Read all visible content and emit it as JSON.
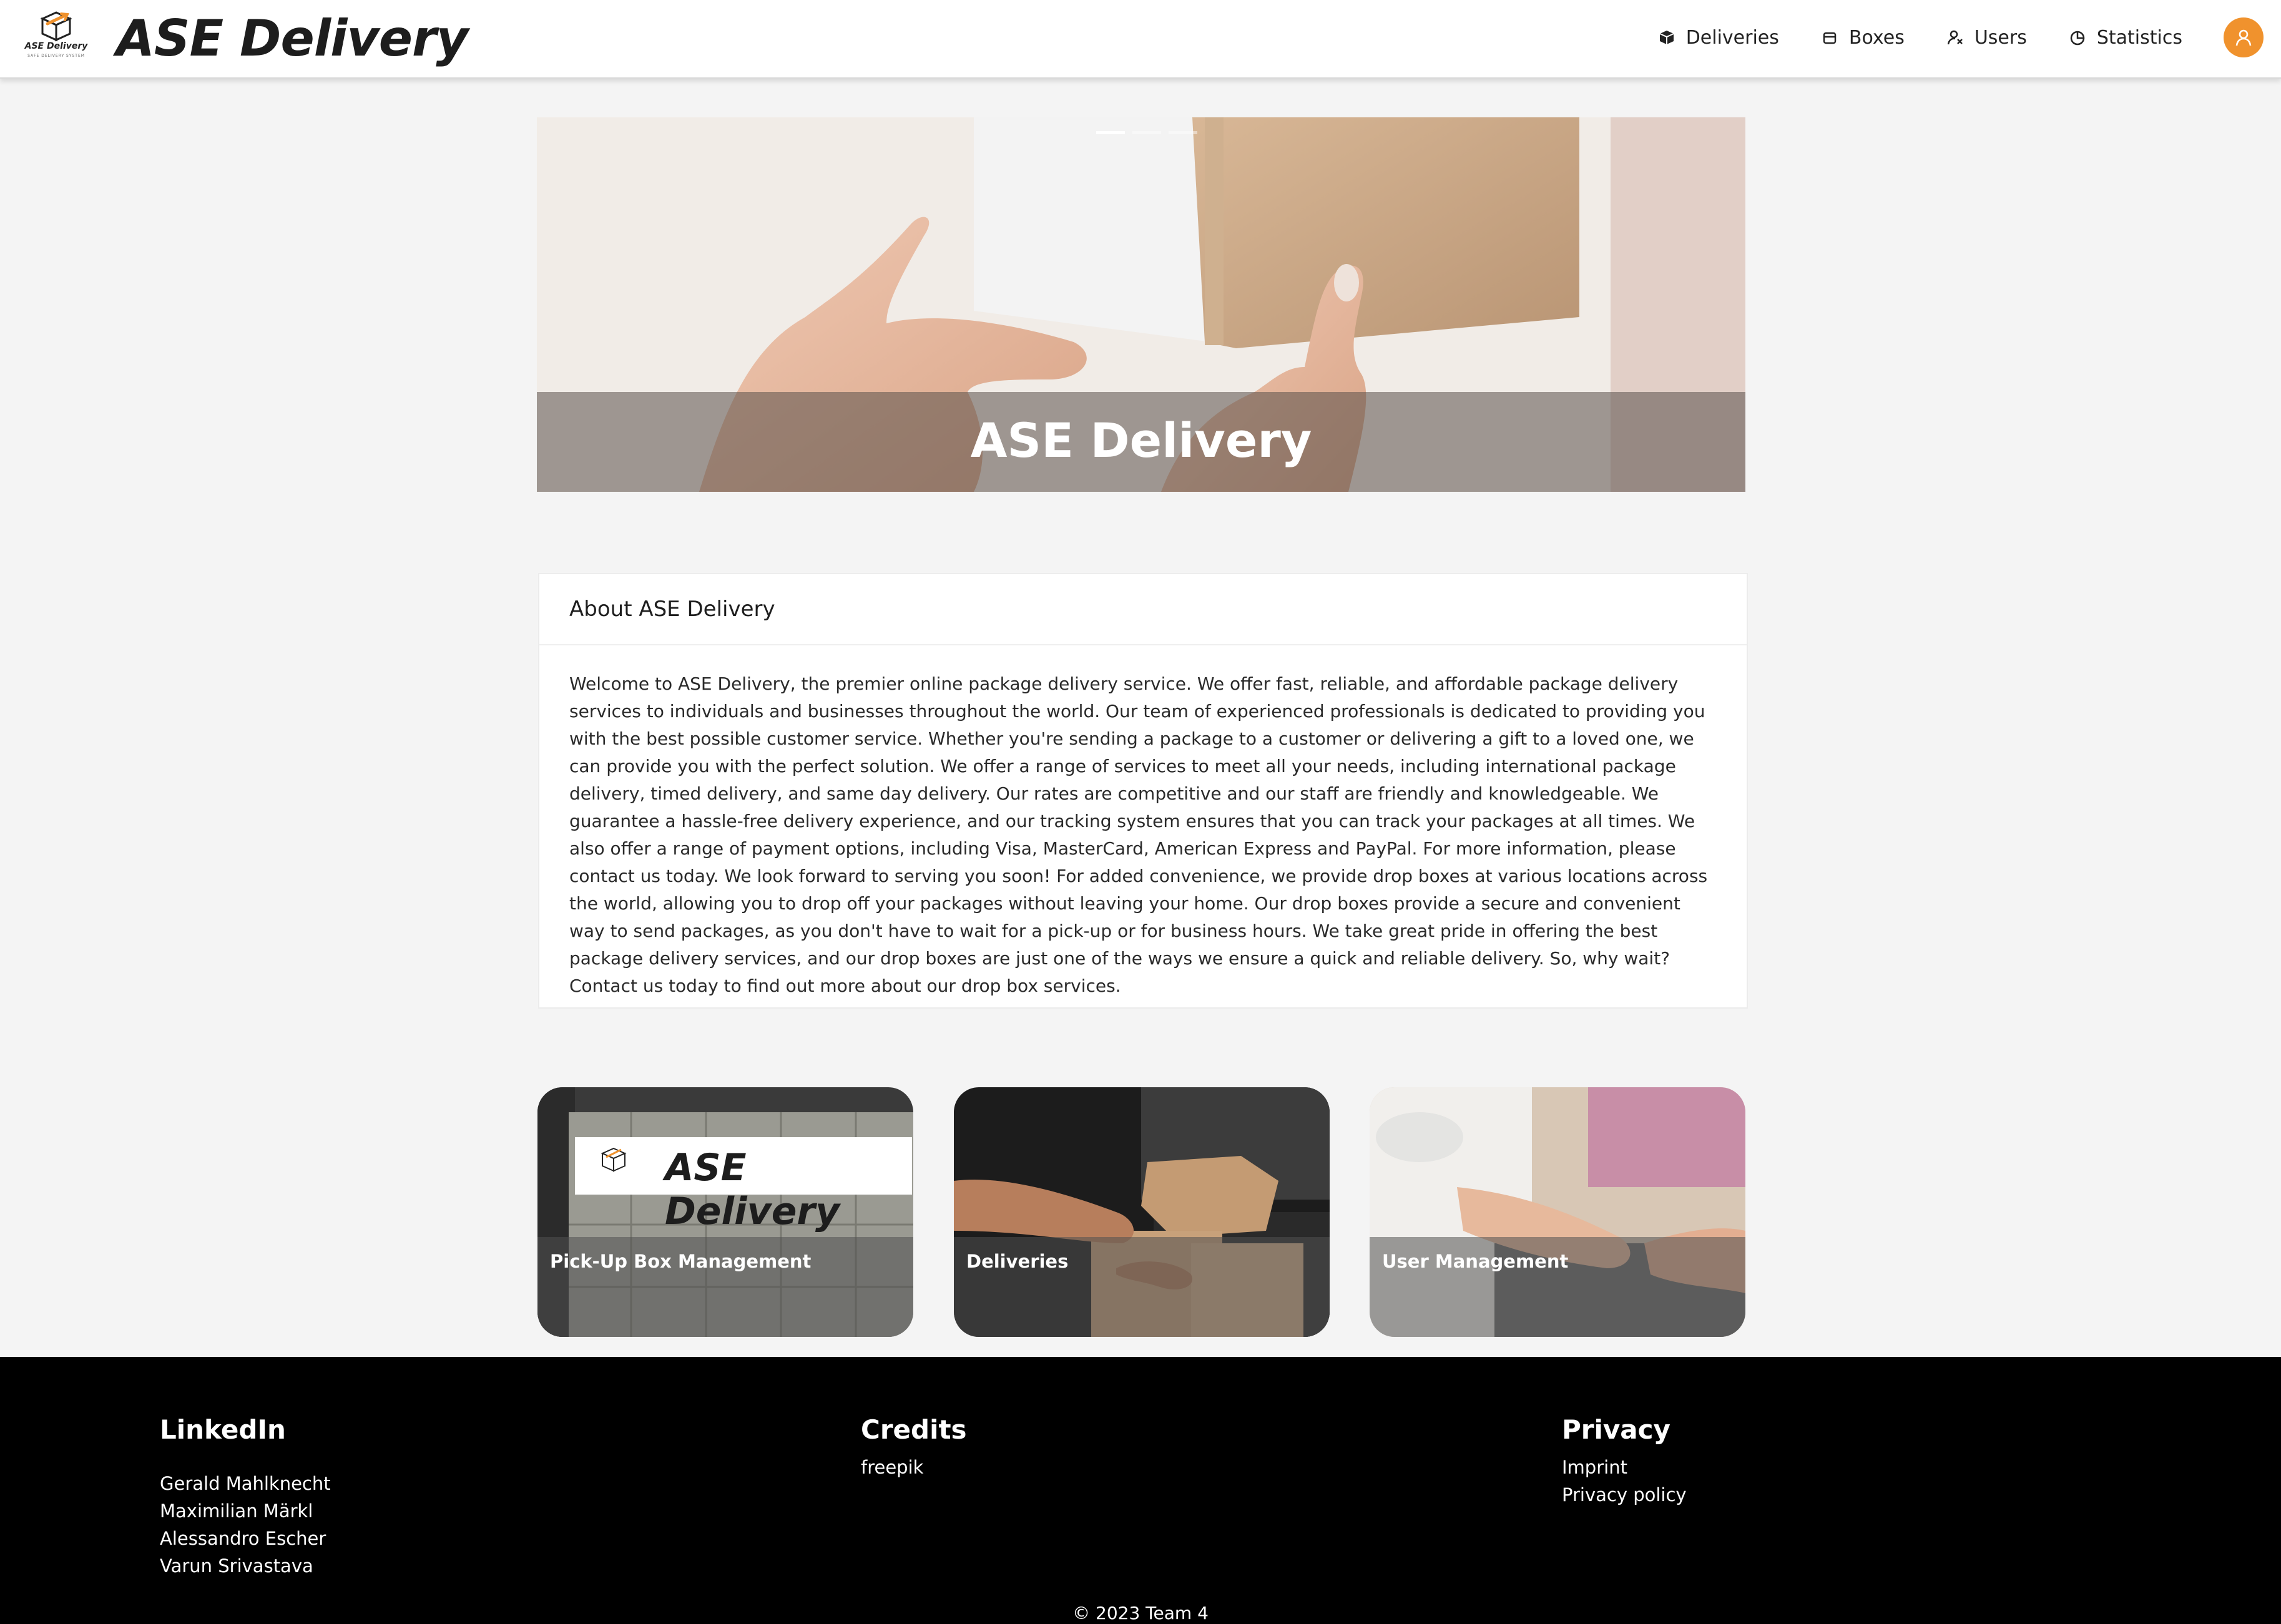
{
  "header": {
    "logo_text": "ASE Delivery",
    "logo_subtext": "SAFE DELIVERY SYSTEM",
    "brand_title": "ASE Delivery",
    "nav": [
      {
        "label": "Deliveries",
        "icon": "deliveries-icon"
      },
      {
        "label": "Boxes",
        "icon": "box-icon"
      },
      {
        "label": "Users",
        "icon": "users-icon"
      },
      {
        "label": "Statistics",
        "icon": "statistics-icon"
      }
    ],
    "avatar_icon": "user-icon",
    "accent": "#f0922d"
  },
  "hero": {
    "caption": "ASE Delivery",
    "indicators": 3,
    "active_index": 0
  },
  "about": {
    "title": "About ASE Delivery",
    "text": "Welcome to ASE Delivery, the premier online package delivery service. We offer fast, reliable, and affordable package delivery services to individuals and businesses throughout the world. Our team of experienced professionals is dedicated to providing you with the best possible customer service. Whether you're sending a package to a customer or delivering a gift to a loved one, we can provide you with the perfect solution. We offer a range of services to meet all your needs, including international package delivery, timed delivery, and same day delivery. Our rates are competitive and our staff are friendly and knowledgeable. We guarantee a hassle-free delivery experience, and our tracking system ensures that you can track your packages at all times. We also offer a range of payment options, including Visa, MasterCard, American Express and PayPal. For more information, please contact us today. We look forward to serving you soon! For added convenience, we provide drop boxes at various locations across the world, allowing you to drop off your packages without leaving your home. Our drop boxes provide a secure and convenient way to send packages, as you don't have to wait for a pick-up or for business hours. We take great pride in offering the best package delivery services, and our drop boxes are just one of the ways we ensure a quick and reliable delivery. So, why wait? Contact us today to find out more about our drop box services."
  },
  "tiles": [
    {
      "label": "Pick-Up Box Management",
      "sign_text": "ASE Delivery"
    },
    {
      "label": "Deliveries"
    },
    {
      "label": "User Management"
    }
  ],
  "footer": {
    "linkedin": {
      "title": "LinkedIn",
      "links": [
        "Gerald Mahlknecht",
        "Maximilian Märkl",
        "Alessandro Escher",
        "Varun Srivastava"
      ]
    },
    "credits": {
      "title": "Credits",
      "links": [
        "freepik"
      ]
    },
    "privacy": {
      "title": "Privacy",
      "links": [
        "Imprint",
        "Privacy policy"
      ]
    },
    "copyright": "© 2023 Team 4"
  }
}
